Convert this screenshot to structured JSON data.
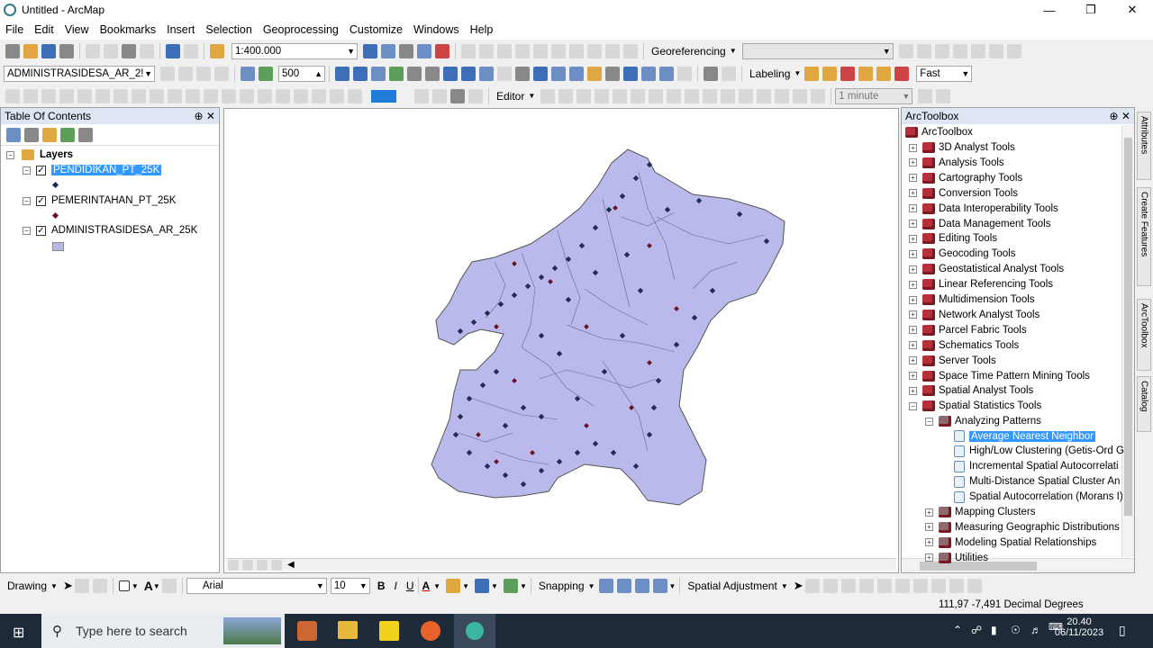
{
  "window": {
    "title": "Untitled - ArcMap"
  },
  "menu": [
    "File",
    "Edit",
    "View",
    "Bookmarks",
    "Insert",
    "Selection",
    "Geoprocessing",
    "Customize",
    "Windows",
    "Help"
  ],
  "toolbar": {
    "scale": "1:400.000",
    "georef_label": "Georeferencing",
    "layer_combo": "ADMINISTRASIDESA_AR_2!",
    "number_box": "500",
    "labeling_label": "Labeling",
    "fast_combo": "Fast",
    "editor_label": "Editor",
    "time_combo": "1 minute"
  },
  "toc": {
    "title": "Table Of Contents",
    "root": "Layers",
    "layers": [
      {
        "name": "PENDIDIKAN_PT_25K",
        "selected": true,
        "symbol_color": "#1a2a5a"
      },
      {
        "name": "PEMERINTAHAN_PT_25K",
        "selected": false,
        "symbol_color": "#6a0e1e"
      },
      {
        "name": "ADMINISTRASIDESA_AR_25K",
        "selected": false,
        "symbol_color": "#b8b8e8"
      }
    ]
  },
  "arctoolbox": {
    "title": "ArcToolbox",
    "root": "ArcToolbox",
    "toolboxes": [
      "3D Analyst Tools",
      "Analysis Tools",
      "Cartography Tools",
      "Conversion Tools",
      "Data Interoperability Tools",
      "Data Management Tools",
      "Editing Tools",
      "Geocoding Tools",
      "Geostatistical Analyst Tools",
      "Linear Referencing Tools",
      "Multidimension Tools",
      "Network Analyst Tools",
      "Parcel Fabric Tools",
      "Schematics Tools",
      "Server Tools",
      "Space Time Pattern Mining Tools",
      "Spatial Analyst Tools",
      "Spatial Statistics Tools"
    ],
    "expanded_toolset": "Analyzing Patterns",
    "tools": [
      "Average Nearest Neighbor",
      "High/Low Clustering (Getis-Ord G",
      "Incremental Spatial Autocorrelati",
      "Multi-Distance Spatial Cluster An",
      "Spatial Autocorrelation (Morans I)"
    ],
    "other_toolsets": [
      "Mapping Clusters",
      "Measuring Geographic Distributions",
      "Modeling Spatial Relationships",
      "Utilities"
    ]
  },
  "side_tabs": [
    "Attributes",
    "Create Features",
    "ArcToolbox",
    "Catalog"
  ],
  "drawing_toolbar": {
    "drawing_label": "Drawing",
    "font": "Arial",
    "font_size": "10",
    "snapping_label": "Snapping",
    "spatial_adjustment_label": "Spatial Adjustment"
  },
  "status": {
    "coords": "111,97  -7,491 Decimal Degrees"
  },
  "taskbar": {
    "search_placeholder": "Type here to search",
    "time": "20.40",
    "date": "06/11/2023"
  }
}
